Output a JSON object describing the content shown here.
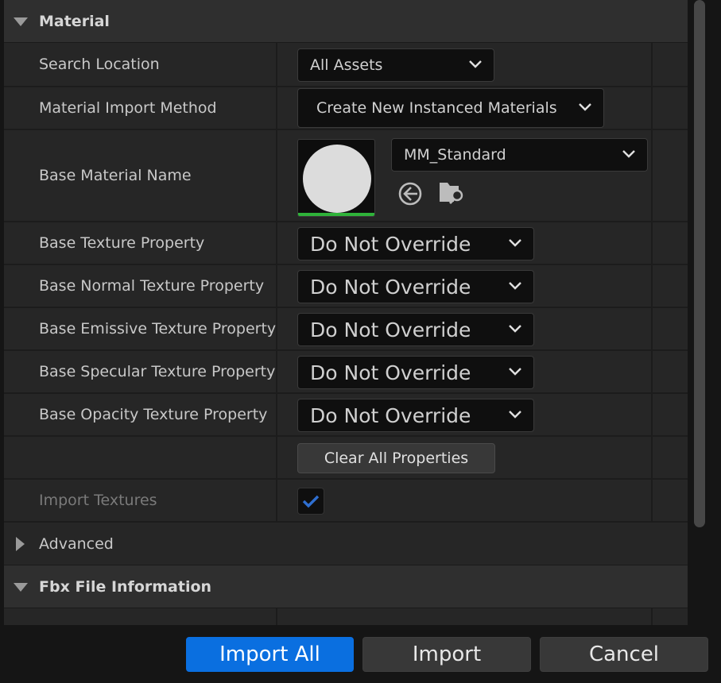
{
  "sections": {
    "material": "Material",
    "advanced": "Advanced",
    "fbx_info": "Fbx File Information"
  },
  "rows": {
    "search_location": {
      "label": "Search Location",
      "value": "All Assets"
    },
    "import_method": {
      "label": "Material Import Method",
      "value": "Create New Instanced Materials"
    },
    "base_material": {
      "label": "Base Material Name",
      "value": "MM_Standard"
    },
    "base_texture": {
      "label": "Base Texture Property",
      "value": "Do Not Override"
    },
    "base_normal": {
      "label": "Base Normal Texture Property",
      "value": "Do Not Override"
    },
    "base_emissive": {
      "label": "Base Emissive Texture Property",
      "value": "Do Not Override"
    },
    "base_specular": {
      "label": "Base Specular Texture Property",
      "value": "Do Not Override"
    },
    "base_opacity": {
      "label": "Base Opacity Texture Property",
      "value": "Do Not Override"
    },
    "clear_all": {
      "label": "Clear All Properties"
    },
    "import_textures": {
      "label": "Import Textures",
      "checked": true
    }
  },
  "footer": {
    "import_all": "Import All",
    "import": "Import",
    "cancel": "Cancel"
  },
  "colors": {
    "accent": "#0a6fe0",
    "checkmark": "#2f6fd0",
    "thumbnail_bar": "#2fb33a"
  }
}
